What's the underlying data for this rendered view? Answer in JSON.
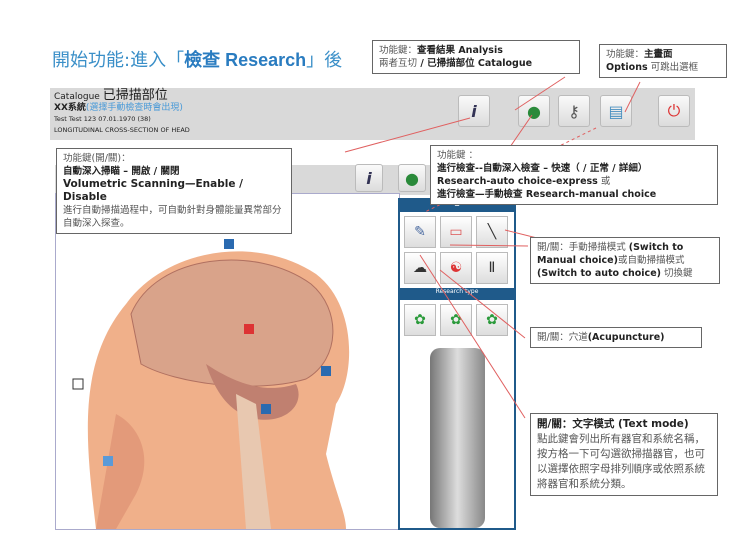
{
  "title": {
    "prefix": "開始功能:進入「",
    "highlight": "檢查 Research",
    "suffix": "」後"
  },
  "header": {
    "catalogue_label": "Catalogue",
    "catalogue_cn": "已掃描部位",
    "system": "XX系統",
    "system_note": "(選擇手動檢查時會出現)",
    "patient": "Test  Test 123   07.01.1970 (38)",
    "section": "LONGITUDINAL CROSS-SECTION OF HEAD"
  },
  "toolbar": {
    "icons": [
      "info-icon",
      "research-icon",
      "analysis-key-icon",
      "options-icon",
      "power-icon"
    ]
  },
  "panel": {
    "section_label": "Research type"
  },
  "callouts": {
    "analysis": {
      "line1_a": "功能鍵：",
      "line1_b": "查看結果 Analysis",
      "line2_a": "兩者互切",
      "line2_b": " / 已掃描部位 Catalogue"
    },
    "options": {
      "line1_a": "功能鍵：",
      "line1_b": "主畫面",
      "line2_b": "Options",
      "line2_a": " 可跳出選框"
    },
    "volumetric": {
      "line1": "功能鍵(開/關)：",
      "line2": "自動深入掃瞄 – 開啟 / 關閉",
      "line3": "Volumetric Scanning—Enable / Disable",
      "line4": "進行自動掃描過程中，可自動針對身體能量異常部分自動深入探查。"
    },
    "research": {
      "line1": "功能鍵 ：",
      "line2": "進行檢查--自動深入檢查 – 快速（ / 正常 / 詳細）",
      "line3": "Research-auto choice-express",
      "line3b": " 或",
      "line4a": "進行檢查—手動檢查 ",
      "line4b": "Research-manual choice"
    },
    "switch": {
      "a": "開/關：手動掃描模式",
      "b": "(Switch to Manual choice)",
      "c": "或",
      "d": "自動掃描模式",
      "e": "(Switch to auto choice)",
      "f": " 切換鍵"
    },
    "acupuncture": {
      "a": "開/關：穴道",
      "b": "(Acupuncture)"
    },
    "text_mode": {
      "a": "開/關：文字模式 (Text mode)",
      "b": "點此鍵會列出所有器官和系統名稱，按方格一下可勾選欲掃描器官，也可以選擇依照字母排列順序或依照系統將器官和系統分類。"
    }
  },
  "colors": {
    "accent": "#3a8fc8",
    "callout_line": "#e06060",
    "panel": "#1f5a8a"
  }
}
